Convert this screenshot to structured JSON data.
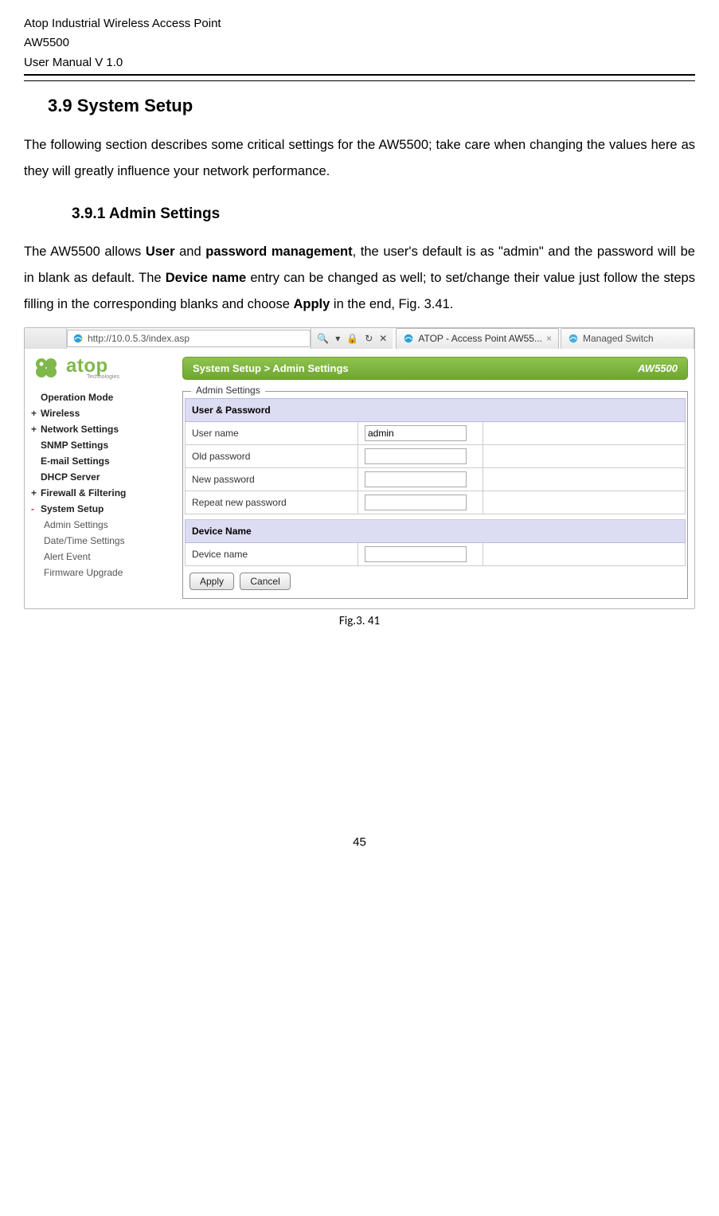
{
  "header": {
    "line1": "Atop Industrial Wireless Access Point",
    "line2": "AW5500",
    "line3": "User Manual V 1.0"
  },
  "section": {
    "number_title": "3.9  System Setup",
    "para1": "The following section describes some critical settings for the AW5500; take care when changing the values here as they will greatly influence your network performance."
  },
  "subsection": {
    "number_title": "3.9.1 Admin Settings",
    "para_pre": "The AW5500 allows ",
    "bold1": "User",
    "mid1": " and ",
    "bold2": "password management",
    "mid2": ", the user's default is as \"admin\" and the password will be in blank as default. The ",
    "bold3": "Device name",
    "mid3": " entry can be changed as well; to set/change their value just follow the steps filling in the corresponding blanks and choose ",
    "bold4": "Apply",
    "mid4": " in the end, Fig. 3.41."
  },
  "browser": {
    "url": "http://10.0.5.3/index.asp",
    "search_placeholder": "",
    "tab_active": "ATOP - Access Point AW55...",
    "tab_inactive": "Managed Switch"
  },
  "logo": {
    "text": "atop",
    "sub": "Technologies"
  },
  "nav": {
    "op_mode": "Operation Mode",
    "wireless": "Wireless",
    "net": "Network Settings",
    "snmp": "SNMP Settings",
    "email": "E-mail Settings",
    "dhcp": "DHCP Server",
    "fw": "Firewall & Filtering",
    "sys": "System Setup",
    "sys_children": {
      "admin": "Admin Settings",
      "dt": "Date/Time Settings",
      "alert": "Alert Event",
      "fwup": "Firmware Upgrade"
    }
  },
  "crumb": {
    "path": "System Setup > Admin Settings",
    "model": "AW5500"
  },
  "panel": {
    "legend": "Admin Settings",
    "user_pw_header": "User & Password",
    "rows": {
      "user_name_label": "User name",
      "user_name_value": "admin",
      "old_pw_label": "Old password",
      "new_pw_label": "New password",
      "rep_pw_label": "Repeat new password"
    },
    "device_header": "Device Name",
    "device_label": "Device name",
    "device_value": "",
    "apply": "Apply",
    "cancel": "Cancel"
  },
  "figure_caption": "Fig.3. 41",
  "page_number": "45"
}
